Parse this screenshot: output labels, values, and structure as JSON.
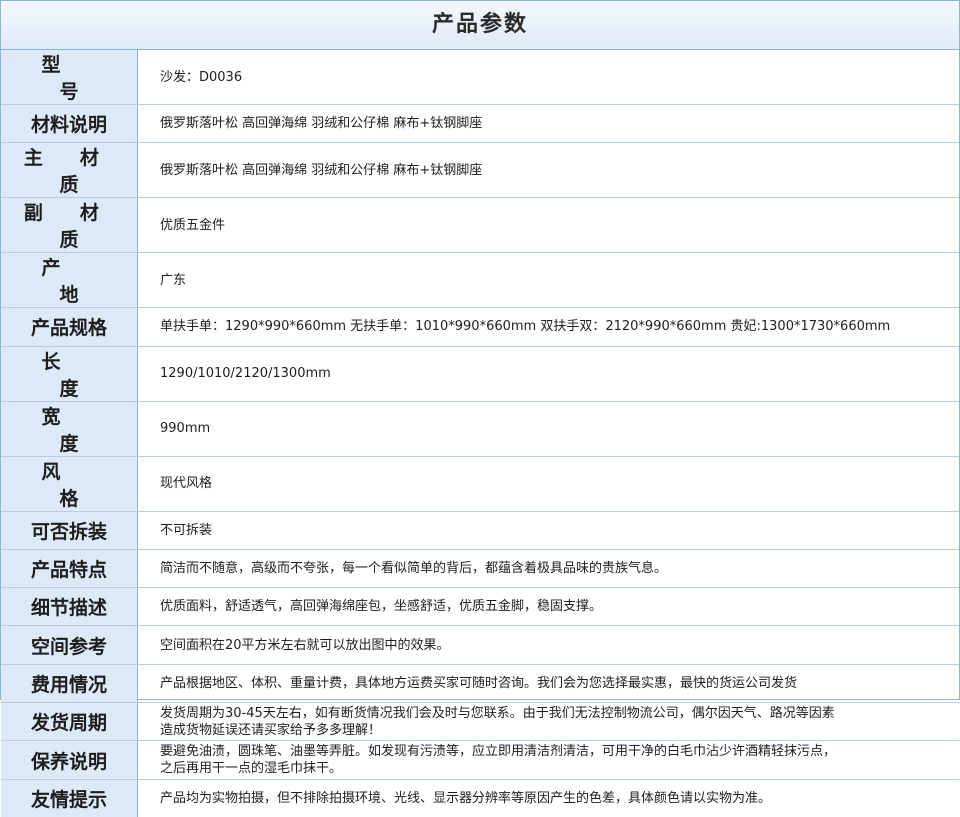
{
  "title": "产品参数",
  "rows": [
    {
      "label": "型　号",
      "value": "沙发：D0036"
    },
    {
      "label": "材料说明",
      "value": "俄罗斯落叶松 高回弹海绵 羽绒和公仔棉 麻布+钛钢脚座"
    },
    {
      "label": "主 材 质",
      "value": "俄罗斯落叶松 高回弹海绵 羽绒和公仔棉 麻布+钛钢脚座"
    },
    {
      "label": "副 材 质",
      "value": "优质五金件"
    },
    {
      "label": "产　地",
      "value": "广东"
    },
    {
      "label": "产品规格",
      "value": "单扶手单：1290*990*660mm 无扶手单：1010*990*660mm 双扶手双：2120*990*660mm 贵妃:1300*1730*660mm"
    },
    {
      "label": "长　度",
      "value": "1290/1010/2120/1300mm"
    },
    {
      "label": "宽　度",
      "value": "990mm"
    },
    {
      "label": "风　格",
      "value": "现代风格"
    },
    {
      "label": "可否拆装",
      "value": "不可拆装"
    },
    {
      "label": "产品特点",
      "value": "简洁而不随意，高级而不夸张，每一个看似简单的背后，都蕴含着极具品味的贵族气息。"
    },
    {
      "label": "细节描述",
      "value": "优质面料，舒适透气，高回弹海绵座包，坐感舒适，优质五金脚，稳固支撑。"
    },
    {
      "label": "空间参考",
      "value": "空间面积在20平方米左右就可以放出图中的效果。"
    },
    {
      "label": "费用情况",
      "value": "产品根据地区、体积、重量计费，具体地方运费买家可随时咨询。我们会为您选择最实惠，最快的货运公司发货"
    },
    {
      "label": "发货周期",
      "value_lines": [
        "发货周期为30-45天左右，如有断货情况我们会及时与您联系。由于我们无法控制物流公司，偶尔因天气、路况等因素",
        "造成货物延误还请买家给予多多理解！"
      ]
    },
    {
      "label": "保养说明",
      "value_lines": [
        "要避免油渍，圆珠笔、油墨等弄脏。如发现有污渍等，应立即用清洁剂清洁，可用干净的白毛巾沾少许酒精轻抹污点，",
        "之后再用干一点的湿毛巾抹干。"
      ]
    },
    {
      "label": "友情提示",
      "value": "产品均为实物拍摄，但不排除拍摄环境、光线、显示器分辨率等原因产生的色差，具体颜色请以实物为准。"
    }
  ]
}
